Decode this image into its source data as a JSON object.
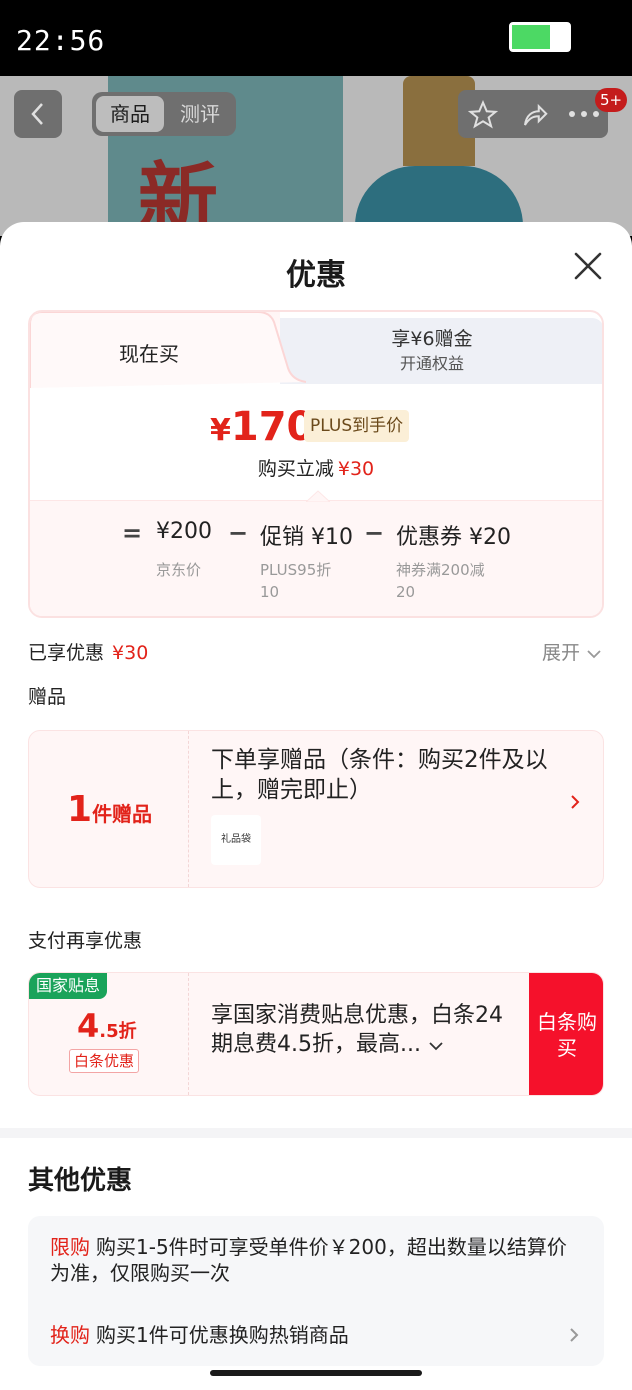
{
  "status": {
    "time": "22:56"
  },
  "product_nav": {
    "back_icon": "chevron-left-icon",
    "tabs": [
      {
        "label": "商品"
      },
      {
        "label": "测评"
      }
    ],
    "badge": "5+",
    "logo_text": "新"
  },
  "sheet": {
    "title": "优惠",
    "tabs": {
      "now": "现在买",
      "plus_main": "享¥6赠金",
      "plus_sub": "开通权益"
    },
    "price": {
      "symbol": "¥",
      "value": "170",
      "tag": "PLUS到手价",
      "instant_cut_label": "购买立减",
      "instant_cut_value": "¥30"
    },
    "breakdown": [
      {
        "op": "=",
        "value": "¥200",
        "label": "京东价",
        "sub": ""
      },
      {
        "op": "−",
        "value": "促销 ¥10",
        "label": "PLUS95折",
        "sub": "10"
      },
      {
        "op": "−",
        "value": "优惠券 ¥20",
        "label": "神券满200减",
        "sub": "20"
      }
    ],
    "enjoyed": {
      "label": "已享优惠",
      "value": "¥30"
    },
    "expand": "展开",
    "gift_section_label": "赠品",
    "gift": {
      "count": "1",
      "count_unit": "件赠品",
      "text": "下单享赠品（条件：购买2件及以上，赠完即止）",
      "thumb_label": "礼品袋"
    },
    "pay_section_label": "支付再享优惠",
    "pay": {
      "nation_tag": "国家贴息",
      "rate_value": "4",
      "rate_unit": ".5折",
      "baitiao_tag": "白条优惠",
      "text": "享国家消费贴息优惠，白条24期息费4.5折，最高...",
      "button": "白条购买"
    },
    "other_title": "其他优惠",
    "other": [
      {
        "tag": "限购",
        "text": "购买1-5件时可享受单件价￥200，超出数量以结算价为准，仅限购买一次"
      },
      {
        "tag": "换购",
        "text": "购买1件可优惠换购热销商品"
      }
    ]
  },
  "colors": {
    "accent_red": "#e2231a",
    "button_red": "#f5112b",
    "green_tag": "#1aa35a"
  }
}
